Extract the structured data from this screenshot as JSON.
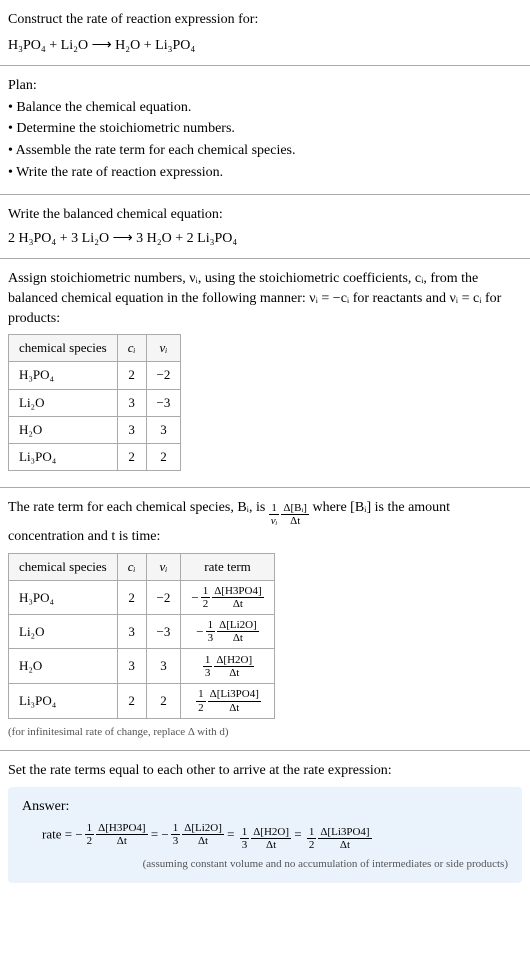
{
  "header": {
    "title": "Construct the rate of reaction expression for:",
    "equation": "H₃PO₄ + Li₂O ⟶ H₂O + Li₃PO₄"
  },
  "plan": {
    "label": "Plan:",
    "items": [
      "• Balance the chemical equation.",
      "• Determine the stoichiometric numbers.",
      "• Assemble the rate term for each chemical species.",
      "• Write the rate of reaction expression."
    ]
  },
  "balance": {
    "label": "Write the balanced chemical equation:",
    "equation": "2 H₃PO₄ + 3 Li₂O ⟶ 3 H₂O + 2 Li₃PO₄"
  },
  "stoich": {
    "text1": "Assign stoichiometric numbers, νᵢ, using the stoichiometric coefficients, cᵢ, from the balanced chemical equation in the following manner: νᵢ = −cᵢ for reactants and νᵢ = cᵢ for products:",
    "headers": [
      "chemical species",
      "cᵢ",
      "νᵢ"
    ],
    "rows": [
      {
        "species": "H₃PO₄",
        "c": "2",
        "v": "−2"
      },
      {
        "species": "Li₂O",
        "c": "3",
        "v": "−3"
      },
      {
        "species": "H₂O",
        "c": "3",
        "v": "3"
      },
      {
        "species": "Li₃PO₄",
        "c": "2",
        "v": "2"
      }
    ]
  },
  "rateterm": {
    "text_before": "The rate term for each chemical species, Bᵢ, is",
    "text_after": "where [Bᵢ] is the amount concentration and t is time:",
    "frac1_num": "1",
    "frac1_den": "νᵢ",
    "frac2_num": "Δ[Bᵢ]",
    "frac2_den": "Δt",
    "headers": [
      "chemical species",
      "cᵢ",
      "νᵢ",
      "rate term"
    ],
    "rows": [
      {
        "species": "H₃PO₄",
        "c": "2",
        "v": "−2",
        "coef": "−",
        "n": "1",
        "d": "2",
        "deltaNum": "Δ[H3PO4]",
        "deltaDen": "Δt"
      },
      {
        "species": "Li₂O",
        "c": "3",
        "v": "−3",
        "coef": "−",
        "n": "1",
        "d": "3",
        "deltaNum": "Δ[Li2O]",
        "deltaDen": "Δt"
      },
      {
        "species": "H₂O",
        "c": "3",
        "v": "3",
        "coef": "",
        "n": "1",
        "d": "3",
        "deltaNum": "Δ[H2O]",
        "deltaDen": "Δt"
      },
      {
        "species": "Li₃PO₄",
        "c": "2",
        "v": "2",
        "coef": "",
        "n": "1",
        "d": "2",
        "deltaNum": "Δ[Li3PO4]",
        "deltaDen": "Δt"
      }
    ],
    "note": "(for infinitesimal rate of change, replace Δ with d)"
  },
  "final": {
    "text": "Set the rate terms equal to each other to arrive at the rate expression:",
    "answer_label": "Answer:",
    "rate_label": "rate =",
    "terms": [
      {
        "sign": "−",
        "n": "1",
        "d": "2",
        "deltaNum": "Δ[H3PO4]",
        "deltaDen": "Δt"
      },
      {
        "sign": "−",
        "n": "1",
        "d": "3",
        "deltaNum": "Δ[Li2O]",
        "deltaDen": "Δt"
      },
      {
        "sign": "",
        "n": "1",
        "d": "3",
        "deltaNum": "Δ[H2O]",
        "deltaDen": "Δt"
      },
      {
        "sign": "",
        "n": "1",
        "d": "2",
        "deltaNum": "Δ[Li3PO4]",
        "deltaDen": "Δt"
      }
    ],
    "eq": "=",
    "note": "(assuming constant volume and no accumulation of intermediates or side products)"
  }
}
